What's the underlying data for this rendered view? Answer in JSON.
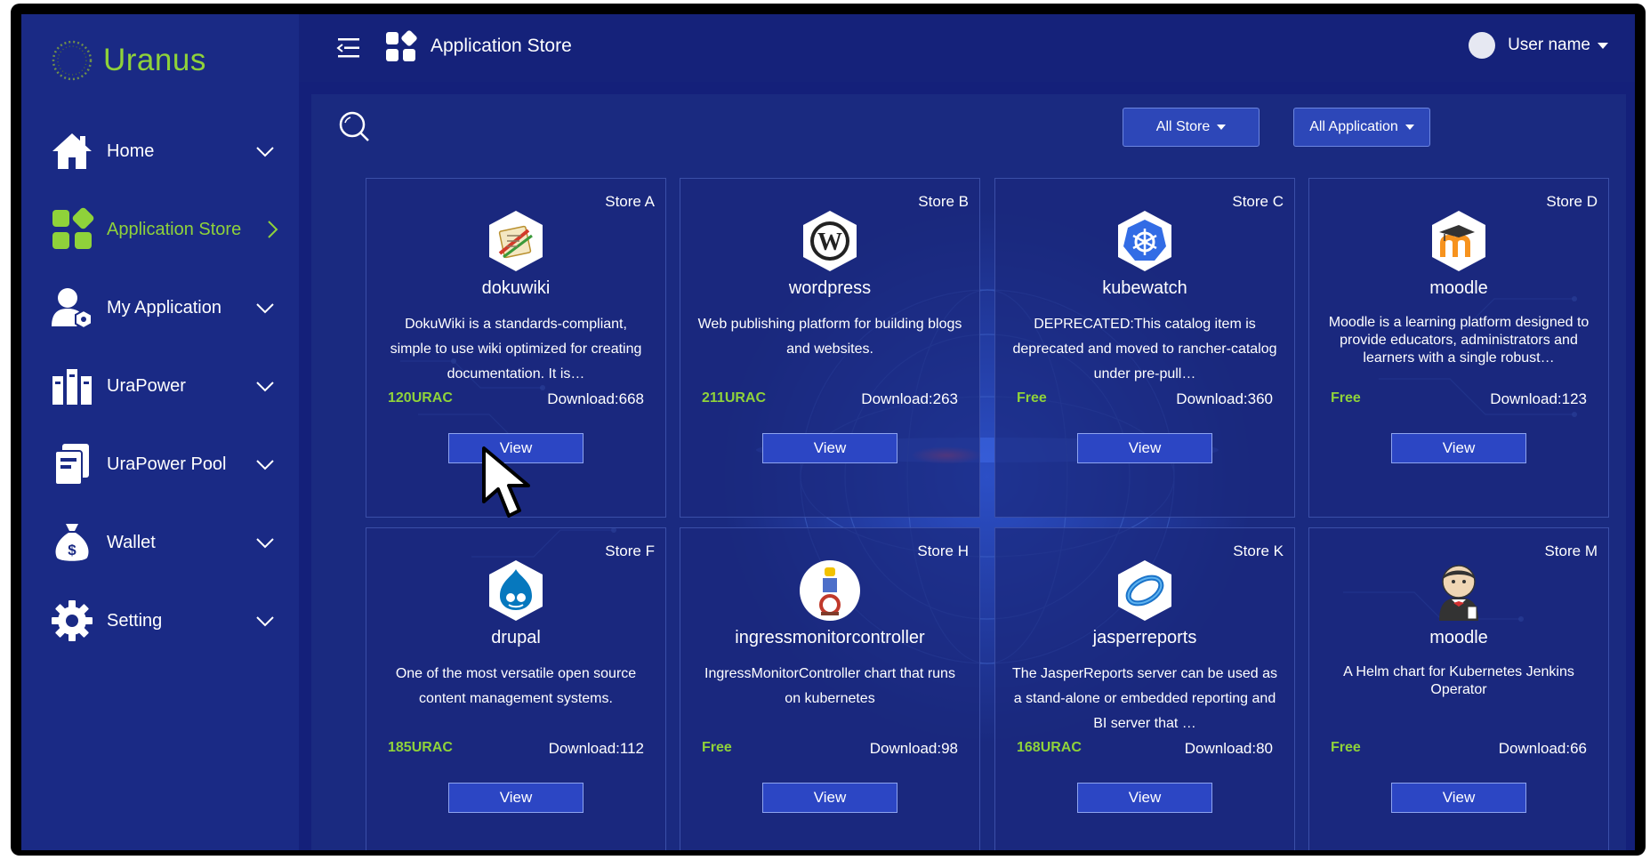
{
  "app": {
    "name": "Uranus"
  },
  "sidebar": {
    "items": [
      {
        "label": "Home",
        "icon": "home-icon",
        "active": false
      },
      {
        "label": "Application Store",
        "icon": "app-grid-icon",
        "active": true
      },
      {
        "label": "My Application",
        "icon": "user-app-icon",
        "active": false
      },
      {
        "label": "UraPower",
        "icon": "server-icon",
        "active": false
      },
      {
        "label": "UraPower Pool",
        "icon": "pool-icon",
        "active": false
      },
      {
        "label": "Wallet",
        "icon": "money-bag-icon",
        "active": false
      },
      {
        "label": "Setting",
        "icon": "gear-icon",
        "active": false
      }
    ]
  },
  "header": {
    "title": "Application Store",
    "user_name": "User name"
  },
  "filters": {
    "store": "All Store",
    "application": "All Application"
  },
  "cards": [
    {
      "store": "Store A",
      "name": "dokuwiki",
      "desc": "DokuWiki is a standards-compliant, simple to use wiki optimized for creating documentation. It is…",
      "price": "120URAC",
      "downloads": "Download:668",
      "button": "View",
      "logo": "dokuwiki-logo-icon"
    },
    {
      "store": "Store B",
      "name": "wordpress",
      "desc": "Web publishing platform for building blogs and websites.",
      "price": "211URAC",
      "downloads": "Download:263",
      "button": "View",
      "logo": "wordpress-logo-icon"
    },
    {
      "store": "Store C",
      "name": "kubewatch",
      "desc": "DEPRECATED:This catalog item is deprecated and moved to rancher-catalog under pre-pull…",
      "price": "Free",
      "downloads": "Download:360",
      "button": "View",
      "logo": "kubernetes-logo-icon"
    },
    {
      "store": "Store D",
      "name": "moodle",
      "desc": "Moodle is a learning platform designed to provide educators, administrators and learners with a single robust…",
      "price": "Free",
      "downloads": "Download:123",
      "button": "View",
      "logo": "moodle-logo-icon"
    },
    {
      "store": "Store  F",
      "name": "drupal",
      "desc": "One of the most versatile open source content management systems.",
      "price": "185URAC",
      "downloads": "Download:112",
      "button": "View",
      "logo": "drupal-logo-icon"
    },
    {
      "store": "Store H",
      "name": "ingressmonitorcontroller",
      "desc": "IngressMonitorController chart that runs on kubernetes",
      "price": "Free",
      "downloads": "Download:98",
      "button": "View",
      "logo": "ingress-logo-icon"
    },
    {
      "store": "Store K",
      "name": "jasperreports",
      "desc": "The JasperReports server can be used as a stand-alone or embedded reporting and BI server that …",
      "price": "168URAC",
      "downloads": "Download:80",
      "button": "View",
      "logo": "jasper-logo-icon"
    },
    {
      "store": "Store M",
      "name": "moodle",
      "desc": "A Helm chart for Kubernetes Jenkins Operator",
      "price": "Free",
      "downloads": "Download:66",
      "button": "View",
      "logo": "jenkins-logo-icon"
    }
  ],
  "colors": {
    "accent": "#8fd23a",
    "background": "#14207a",
    "sidebar": "#1a2a85",
    "button": "#2c46c4"
  }
}
